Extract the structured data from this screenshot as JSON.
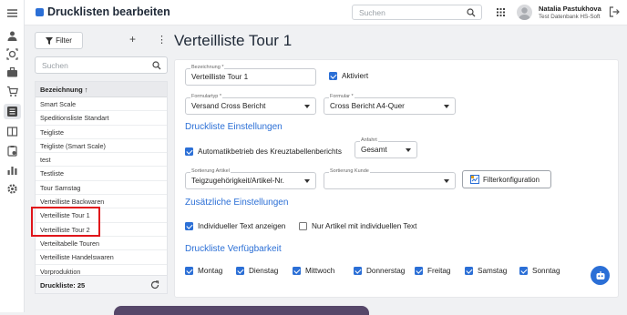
{
  "header": {
    "title": "Drucklisten bearbeiten",
    "search_placeholder": "Suchen",
    "user_name": "Natalia Pastukhova",
    "user_subtitle": "Test Datenbank HS-Soft"
  },
  "rail": {
    "icons": [
      "menu-icon",
      "person-icon",
      "target-icon",
      "briefcase-icon",
      "cart-icon",
      "list-icon",
      "columns-icon",
      "clipboard-icon",
      "bar-chart-icon",
      "gear-icon"
    ]
  },
  "left": {
    "filter_label": "Filter",
    "search_placeholder": "Suchen",
    "column_header": "Bezeichnung ↑",
    "items": [
      "Smart Scale",
      "Speditionsliste Standart",
      "Teigliste",
      "Teigliste (Smart Scale)",
      "test",
      "Testliste",
      "Tour Samstag",
      "Verteilliste Backwaren",
      "Verteilliste Tour 1",
      "Verteilliste Tour 2",
      "Verteiltabelle Touren",
      "Verteilliste Handelswaren",
      "Vorproduktion"
    ],
    "footer": "Druckliste: 25"
  },
  "main": {
    "title": "Verteilliste Tour 1",
    "bezeichnung_label": "Bezeichnung *",
    "bezeichnung_value": "Verteilliste Tour 1",
    "aktiviert_label": "Aktiviert",
    "formulartyp_label": "Formulartyp *",
    "formulartyp_value": "Versand Cross Bericht",
    "formular_label": "Formular *",
    "formular_value": "Cross Bericht A4-Quer",
    "section_druckliste": "Druckliste Einstellungen",
    "auto_label": "Automatikbetrieb des Kreuztabellenberichts",
    "anfahrt_label": "Anfahrt",
    "anfahrt_value": "Gesamt",
    "sort_artikel_label": "Sortierung Artikel",
    "sort_artikel_value": "Teigzugehörigkeit/Artikel-Nr.",
    "sort_kunde_label": "Sortierung Kunde",
    "sort_kunde_value": "",
    "filterkonfig_label": "Filterkonfiguration",
    "section_zusaetzliche": "Zusätzliche Einstellungen",
    "indiv_text_label": "Individueller Text anzeigen",
    "nur_artikel_label": "Nur Artikel mit individuellen Text",
    "section_verfuegbarkeit": "Druckliste Verfügbarkeit",
    "days": [
      "Montag",
      "Dienstag",
      "Mittwoch",
      "Donnerstag",
      "Freitag",
      "Samstag",
      "Sonntag"
    ]
  },
  "colors": {
    "accent": "#2b6fd6",
    "highlight": "#e0151b"
  }
}
